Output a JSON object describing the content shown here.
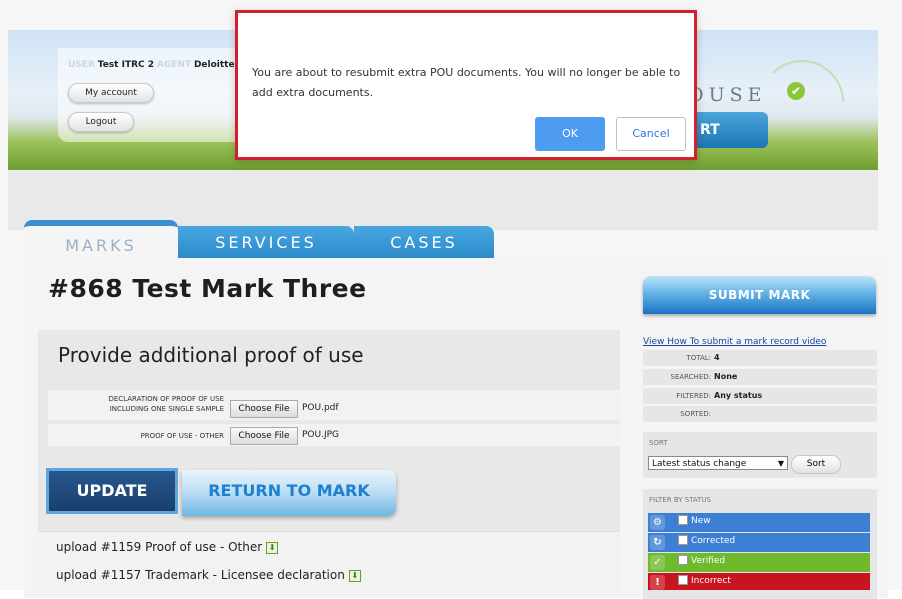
{
  "header": {
    "user_label": "USER",
    "user_name": "Test ITRC 2",
    "agent_label": "AGENT",
    "agent_name": "Deloitte",
    "my_account": "My account",
    "logout": "Logout",
    "logo_text": "OUSE",
    "report_label": "RT"
  },
  "tabs": [
    "MARKS",
    "SERVICES",
    "CASES"
  ],
  "page": {
    "title": "#868 Test Mark Three",
    "section_title": "Provide additional proof of use"
  },
  "form": {
    "rows": [
      {
        "label_line1": "DECLARATION OF PROOF OF USE",
        "label_line2": "INCLUDING ONE SINGLE SAMPLE",
        "button": "Choose File",
        "file": "POU.pdf"
      },
      {
        "label_line1": "PROOF OF USE - OTHER",
        "button": "Choose File",
        "file": "POU.JPG"
      }
    ],
    "update_label": "UPDATE",
    "return_label": "RETURN TO MARK"
  },
  "uploads": [
    "upload #1159 Proof of use - Other",
    "upload #1157 Trademark - Licensee declaration"
  ],
  "sidebar": {
    "submit_label": "SUBMIT MARK",
    "howto_link": "View How To submit a mark record video",
    "stats": [
      {
        "key": "TOTAL:",
        "value": "4"
      },
      {
        "key": "SEARCHED:",
        "value": "None"
      },
      {
        "key": "FILTERED:",
        "value": "Any status"
      },
      {
        "key": "SORTED:",
        "value": ""
      }
    ],
    "sort_caption": "SORT",
    "sort_selected": "Latest status change",
    "sort_button": "Sort",
    "filter_caption": "FILTER BY STATUS",
    "statuses": [
      {
        "label": "New",
        "color": "#3c7fd4",
        "icon": "gear-icon"
      },
      {
        "label": "Corrected",
        "color": "#3c7fd4",
        "icon": "refresh-icon"
      },
      {
        "label": "Verified",
        "color": "#6fba2c",
        "icon": "check-icon"
      },
      {
        "label": "Incorrect",
        "color": "#c8141e",
        "icon": "warning-icon"
      }
    ]
  },
  "dialog": {
    "message": "You are about to resubmit extra POU documents. You will no longer be able to add extra documents.",
    "ok": "OK",
    "cancel": "Cancel"
  },
  "colors": {
    "accent_blue": "#2b8acb",
    "dialog_border": "#d0202c",
    "ok_button": "#4d9cf0"
  }
}
